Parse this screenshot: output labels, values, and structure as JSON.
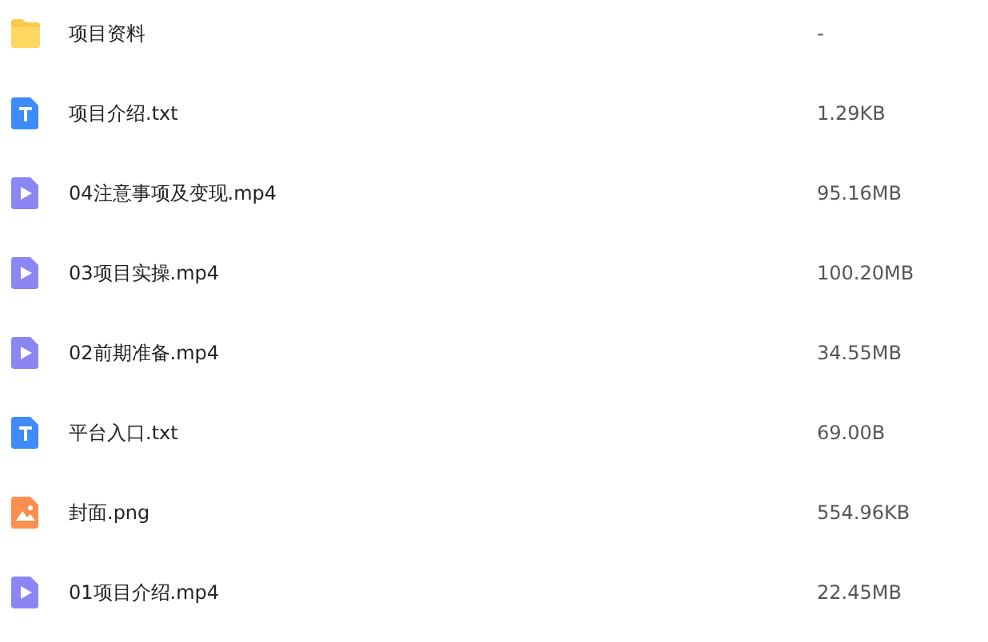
{
  "files": [
    {
      "kind": "folder",
      "name": "项目资料",
      "size": "-"
    },
    {
      "kind": "text",
      "name": "项目介绍.txt",
      "size": "1.29KB"
    },
    {
      "kind": "video",
      "name": "04注意事项及变现.mp4",
      "size": "95.16MB"
    },
    {
      "kind": "video",
      "name": "03项目实操.mp4",
      "size": "100.20MB"
    },
    {
      "kind": "video",
      "name": "02前期准备.mp4",
      "size": "34.55MB"
    },
    {
      "kind": "text",
      "name": "平台入口.txt",
      "size": "69.00B"
    },
    {
      "kind": "image",
      "name": "封面.png",
      "size": "554.96KB"
    },
    {
      "kind": "video",
      "name": "01项目介绍.mp4",
      "size": "22.45MB"
    }
  ]
}
